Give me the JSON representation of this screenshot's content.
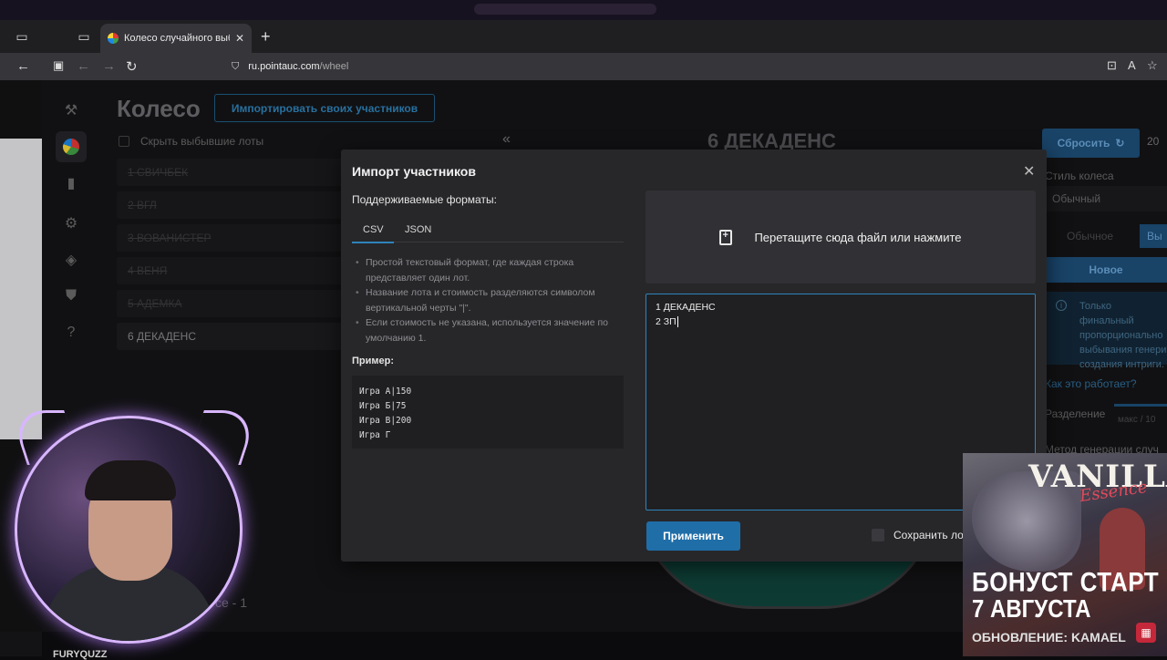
{
  "browser": {
    "tab_title": "Колесо случайного выбора – ",
    "tab_close": "✕",
    "new_tab": "+",
    "url_host": "ru.pointauc.com",
    "url_path": "/wheel"
  },
  "app": {
    "title": "Колесо",
    "import_button": "Импортировать своих участников",
    "hide_eliminated": "Скрыть выбывшие лоты",
    "lots": [
      {
        "label": "1 СВИЧБЕК",
        "eliminated": true
      },
      {
        "label": "2 ВГЛ",
        "eliminated": true
      },
      {
        "label": "3 ВОВАНИСТЕР",
        "eliminated": true
      },
      {
        "label": "4 ВЕНЯ",
        "eliminated": true
      },
      {
        "label": "5 АДЕМКА",
        "eliminated": true
      },
      {
        "label": "6 ДЕКАДЕНС",
        "eliminated": false
      }
    ],
    "collapse_icon": "«",
    "wheel_title": "6 ДЕКАДЕНС",
    "bottom_text": "се - 1",
    "right": {
      "reset_button": "Сбросить",
      "number": "20",
      "wheel_style_label": "Стиль колеса",
      "wheel_style_value": "Обычный",
      "mode_normal": "Обычное",
      "mode_other": "Вы",
      "new_button": "Новое",
      "info_text": "Только финальный пропорционально выбывания генери создания интриги.",
      "how_link": "Как это работает?",
      "split_label": "Разделение",
      "split_max": "макс / 10",
      "gen_method": "Метод генерации случ"
    }
  },
  "modal": {
    "title": "Импорт участников",
    "close": "✕",
    "formats_label": "Поддерживаемые форматы:",
    "tabs": [
      "CSV",
      "JSON"
    ],
    "bullets": [
      "Простой текстовый формат, где каждая строка представляет один лот.",
      "Название лота и стоимость разделяются символом вертикальной черты \"|\".",
      "Если стоимость не указана, используется значение по умолчанию 1."
    ],
    "example_label": "Пример:",
    "example_lines": [
      "Игра А|150",
      "Игра Б|75",
      "Игра В|200",
      "Игра Г"
    ],
    "dropzone": "Перетащите сюда файл или нажмите",
    "text_lines": [
      "1 ДЕКАДЕНС",
      "2 ЗП"
    ],
    "apply_button": "Применить",
    "save_label": "Сохранить ло"
  },
  "stream": {
    "cam_name": "FURYQUZZ",
    "ad_logo": "VANILLA",
    "ad_logo_script": "Essence",
    "ad_line1": "БОНУСТ СТАРТ",
    "ad_line2": "7 АВГУСТА",
    "ad_line3": "ОБНОВЛЕНИЕ: KAMAEL"
  },
  "colors": {
    "accent": "#2f84ba",
    "apply": "#1f6ea8",
    "modal_bg": "#27272a"
  }
}
